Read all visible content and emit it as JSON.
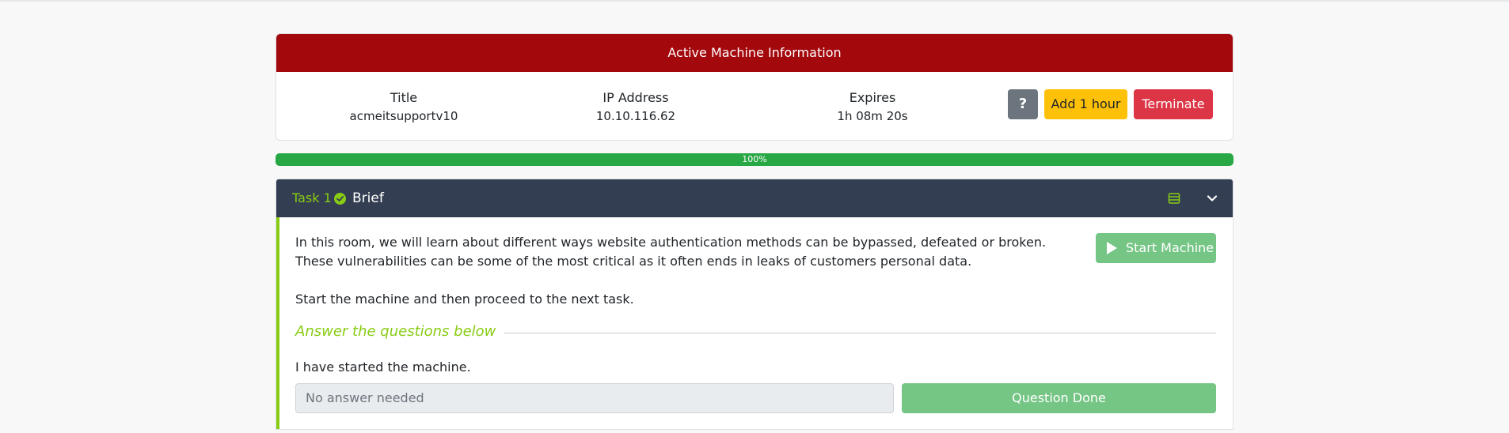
{
  "machine": {
    "header": "Active Machine Information",
    "title_label": "Title",
    "title_value": "acmeitsupportv10",
    "ip_label": "IP Address",
    "ip_value": "10.10.116.62",
    "expires_label": "Expires",
    "expires_value": "1h 08m 20s",
    "help_label": "?",
    "add_hour_label": "Add 1 hour",
    "terminate_label": "Terminate"
  },
  "progress": {
    "value_percent": 100,
    "label": "100%"
  },
  "task": {
    "number": "Task 1",
    "title": "Brief",
    "description_1": "In this room, we will learn about different ways website authentication methods can be bypassed, defeated or broken. These vulnerabilities can be some of the most critical as it often ends in leaks of customers personal data.",
    "description_2": "Start the machine and then proceed to the next task.",
    "start_machine_label": "Start Machine",
    "answer_heading": "Answer the questions below",
    "question": "I have started the machine.",
    "answer_placeholder": "No answer needed",
    "done_label": "Question Done"
  },
  "icons": {
    "check": "check-circle-icon",
    "list": "list-icon",
    "chevron": "chevron-down-icon",
    "play": "play-icon"
  },
  "colors": {
    "header_red": "#a3080c",
    "accent_green": "#88cc14",
    "task_header": "#343e52",
    "success_green": "#28a745",
    "warning_yellow": "#ffc107",
    "danger_red": "#dc3545"
  }
}
